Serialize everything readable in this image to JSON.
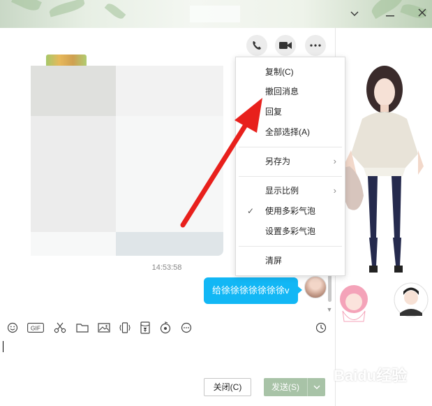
{
  "window": {
    "minimize_icon": "chevron-down-icon",
    "more_icon": "dash-icon",
    "close_icon": "close-icon"
  },
  "chat_header": {
    "buttons": [
      "phone-icon",
      "video-call-icon",
      "more-icon"
    ]
  },
  "messages": {
    "timestamp": "14:53:58",
    "outgoing_text": "给徐徐徐徐徐徐徐v"
  },
  "context_menu": {
    "items": [
      {
        "label": "复制(C)",
        "has_submenu": false,
        "checked": false
      },
      {
        "label": "撤回消息",
        "has_submenu": false,
        "checked": false
      },
      {
        "label": "回复",
        "has_submenu": false,
        "checked": false
      },
      {
        "label": "全部选择(A)",
        "has_submenu": false,
        "checked": false
      },
      {
        "label": "另存为",
        "has_submenu": true,
        "checked": false
      },
      {
        "label": "显示比例",
        "has_submenu": true,
        "checked": false
      },
      {
        "label": "使用多彩气泡",
        "has_submenu": false,
        "checked": true
      },
      {
        "label": "设置多彩气泡",
        "has_submenu": false,
        "checked": false
      },
      {
        "label": "清屏",
        "has_submenu": false,
        "checked": false
      }
    ]
  },
  "toolbar": {
    "tools": [
      "emoji-icon",
      "gif-icon",
      "screenshot-scissors-icon",
      "folder-icon",
      "image-icon",
      "shake-icon",
      "red-packet-icon",
      "music-icon",
      "more-icon",
      "history-clock-icon"
    ],
    "gif_label": "GIF"
  },
  "actions": {
    "close_label": "关闭(C)",
    "send_label": "发送(S)"
  },
  "annotation": {
    "arrow_color": "#e8201c"
  },
  "colors": {
    "bubble": "#12b7f5",
    "send_button": "#a8c3a7"
  },
  "watermark": {
    "text": "Baidu经验"
  }
}
